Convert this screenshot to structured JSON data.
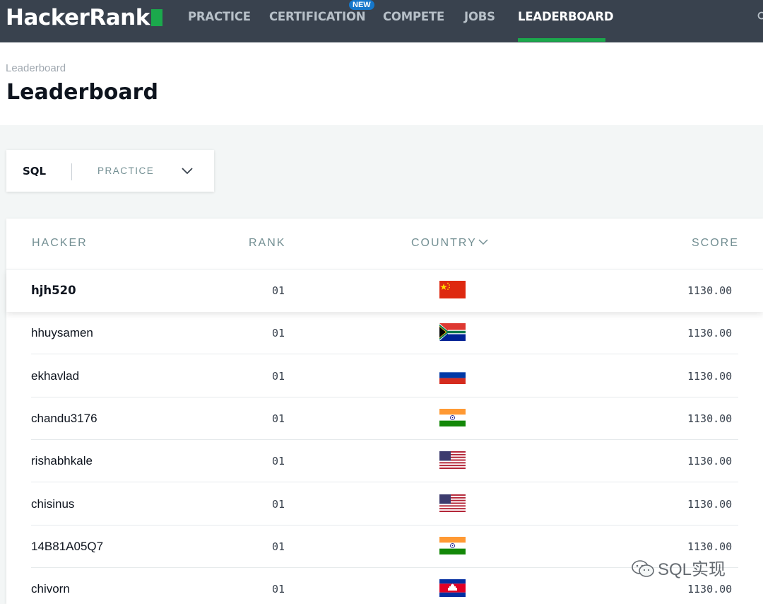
{
  "brand": {
    "name": "HackerRank",
    "accent": "#1ba94c",
    "nav_bg": "#39424e"
  },
  "nav": {
    "items": [
      {
        "label": "PRACTICE"
      },
      {
        "label": "CERTIFICATION",
        "badge": "NEW"
      },
      {
        "label": "COMPETE"
      },
      {
        "label": "JOBS"
      },
      {
        "label": "LEADERBOARD",
        "active": true
      }
    ]
  },
  "breadcrumb": "Leaderboard",
  "page_title": "Leaderboard",
  "filter": {
    "track": "SQL",
    "mode": "PRACTICE"
  },
  "table": {
    "columns": {
      "hacker": "HACKER",
      "rank": "RANK",
      "country": "COUNTRY",
      "score": "SCORE"
    },
    "rows": [
      {
        "hacker": "hjh520",
        "rank": "01",
        "country_flag": "china-flag",
        "score": "1130.00",
        "highlighted": true
      },
      {
        "hacker": "hhuysamen",
        "rank": "01",
        "country_flag": "south-africa-flag",
        "score": "1130.00"
      },
      {
        "hacker": "ekhavlad",
        "rank": "01",
        "country_flag": "russia-flag",
        "score": "1130.00"
      },
      {
        "hacker": "chandu3176",
        "rank": "01",
        "country_flag": "india-flag",
        "score": "1130.00"
      },
      {
        "hacker": "rishabhkale",
        "rank": "01",
        "country_flag": "usa-flag",
        "score": "1130.00"
      },
      {
        "hacker": "chisinus",
        "rank": "01",
        "country_flag": "usa-flag",
        "score": "1130.00"
      },
      {
        "hacker": "14B81A05Q7",
        "rank": "01",
        "country_flag": "india-flag",
        "score": "1130.00"
      },
      {
        "hacker": "chivorn",
        "rank": "01",
        "country_flag": "cambodia-flag",
        "score": "1130.00"
      }
    ]
  },
  "watermark": "SQL实现"
}
